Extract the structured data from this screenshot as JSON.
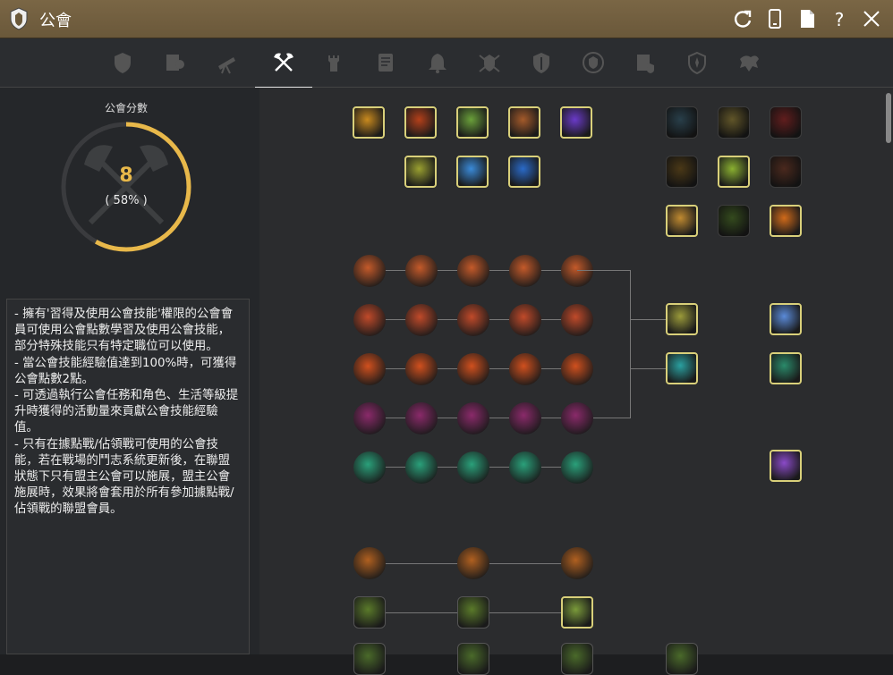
{
  "window": {
    "title": "公會",
    "logo_icon": "guild-crest-icon",
    "buttons": [
      {
        "name": "refresh-button",
        "icon": "refresh-icon"
      },
      {
        "name": "mobile-button",
        "icon": "phone-icon"
      },
      {
        "name": "document-button",
        "icon": "document-icon"
      },
      {
        "name": "help-button",
        "icon": "question-icon"
      },
      {
        "name": "close-button",
        "icon": "close-icon"
      }
    ]
  },
  "tabs": [
    {
      "name": "tab-guild-info",
      "icon": "shield-crest-icon",
      "active": false
    },
    {
      "name": "tab-guild-members",
      "icon": "members-icon",
      "active": false
    },
    {
      "name": "tab-guild-quests",
      "icon": "telescope-icon",
      "active": false
    },
    {
      "name": "tab-guild-skills",
      "icon": "crossed-axes-icon",
      "active": true
    },
    {
      "name": "tab-guild-castle",
      "icon": "tower-icon",
      "active": false
    },
    {
      "name": "tab-guild-scroll",
      "icon": "scroll-icon",
      "active": false
    },
    {
      "name": "tab-guild-notice",
      "icon": "bell-icon",
      "active": false
    },
    {
      "name": "tab-guild-war",
      "icon": "war-crest-icon",
      "active": false
    },
    {
      "name": "tab-guild-defense",
      "icon": "shield-icon",
      "active": false
    },
    {
      "name": "tab-guild-emblem",
      "icon": "emblem-icon",
      "active": false
    },
    {
      "name": "tab-guild-records",
      "icon": "records-icon",
      "active": false
    },
    {
      "name": "tab-guild-alliance",
      "icon": "fleur-shield-icon",
      "active": false
    },
    {
      "name": "tab-guild-mount",
      "icon": "dragon-icon",
      "active": false
    }
  ],
  "score": {
    "label": "公會分數",
    "value": "8",
    "percent_text": "( 58% )",
    "percent": 58,
    "accent": "#e8b84a",
    "track": "#3a3b3e"
  },
  "description": [
    "- 擁有'習得及使用公會技能'權限的公會會員可使用公會點數學習及使用公會技能，部分特殊技能只有特定職位可以使用。",
    "- 當公會技能經驗值達到100%時，可獲得公會點數2點。",
    "- 可透過執行公會任務和角色、生活等級提升時獲得的活動量來貢獻公會技能經驗值。",
    "- 只有在據點戰/佔領戰可使用的公會技能，若在戰場的鬥志系統更新後，在聯盟狀態下只有盟主公會可以施展，盟主公會施展時，效果將會套用於所有參加據點戰/佔領戰的聯盟會員。"
  ],
  "skills": [
    {
      "id": "skill-gold-hand",
      "icon": "golden-hand-icon",
      "color": "#c98a1e",
      "learned": true
    },
    {
      "id": "skill-red-fist",
      "icon": "red-fist-icon",
      "color": "#b4401a",
      "learned": true
    },
    {
      "id": "skill-green-warrior",
      "icon": "green-warrior-icon",
      "color": "#6aa03a",
      "learned": true
    },
    {
      "id": "skill-crossed-swords",
      "icon": "crossed-swords-icon",
      "color": "#a45a2a",
      "learned": true
    },
    {
      "id": "skill-purple-orb",
      "icon": "purple-orb-icon",
      "color": "#6a3ac8",
      "learned": true
    },
    {
      "id": "skill-dark-figure",
      "icon": "dark-figure-icon",
      "color": "#3a5a6a",
      "learned": false
    },
    {
      "id": "skill-gold-coins",
      "icon": "gold-coins-icon",
      "color": "#8a7a3a",
      "learned": false
    },
    {
      "id": "skill-red-banner",
      "icon": "red-banner-icon",
      "color": "#8a2a2a",
      "learned": false
    },
    {
      "id": "skill-leaf-blade",
      "icon": "leaf-blade-icon",
      "color": "#9aa030",
      "learned": true
    },
    {
      "id": "skill-blue-heal",
      "icon": "blue-heal-icon",
      "color": "#3a8ad8",
      "learned": true
    },
    {
      "id": "skill-blue-boot",
      "icon": "blue-boot-icon",
      "color": "#2a6ac8",
      "learned": true
    },
    {
      "id": "skill-dark-gold",
      "icon": "dark-gold-icon",
      "color": "#6a5020",
      "learned": false
    },
    {
      "id": "skill-clover",
      "icon": "clover-icon",
      "color": "#8ab030",
      "learned": true
    },
    {
      "id": "skill-beast",
      "icon": "beast-icon",
      "color": "#6a3a2a",
      "learned": false
    },
    {
      "id": "skill-gold-claw",
      "icon": "gold-claw-icon",
      "color": "#c08a30",
      "learned": true
    },
    {
      "id": "skill-green-shadow",
      "icon": "green-shadow-icon",
      "color": "#4a6a2a",
      "learned": false
    },
    {
      "id": "skill-fire-swirl",
      "icon": "fire-swirl-icon",
      "color": "#d06a1a",
      "learned": true
    }
  ],
  "passives": {
    "rows": [
      {
        "icon": "flame-horns-icon",
        "color": "#c45a2a",
        "count": 5
      },
      {
        "icon": "flame-sword-icon",
        "color": "#c04a2a",
        "count": 5
      },
      {
        "icon": "fire-orb-icon",
        "color": "#d0501e",
        "count": 5
      },
      {
        "icon": "demon-hand-icon",
        "color": "#8a2a6a",
        "count": 5
      },
      {
        "icon": "green-wind-icon",
        "color": "#2aa07a",
        "count": 5
      }
    ],
    "branch": [
      {
        "icon": "yellow-figure-icon",
        "color": "#9a9a3a",
        "learned": true
      },
      {
        "icon": "cyan-spirit-icon",
        "color": "#2aa0a0",
        "learned": true
      },
      {
        "icon": "angel-wing-icon",
        "color": "#5a8ad8",
        "learned": true
      },
      {
        "icon": "green-spirit-icon",
        "color": "#2a8a6a",
        "learned": true
      },
      {
        "icon": "purple-burst-icon",
        "color": "#8a4ac8",
        "learned": true
      }
    ],
    "lamps": {
      "icon": "torch-icon",
      "color": "#b06020",
      "count": 3
    },
    "moons": {
      "icon": "green-moon-icon",
      "color": "#5a7a2a",
      "count": 3
    },
    "bottom": {
      "icon": "green-moon-icon",
      "color": "#4a6a2a",
      "count": 4
    }
  }
}
